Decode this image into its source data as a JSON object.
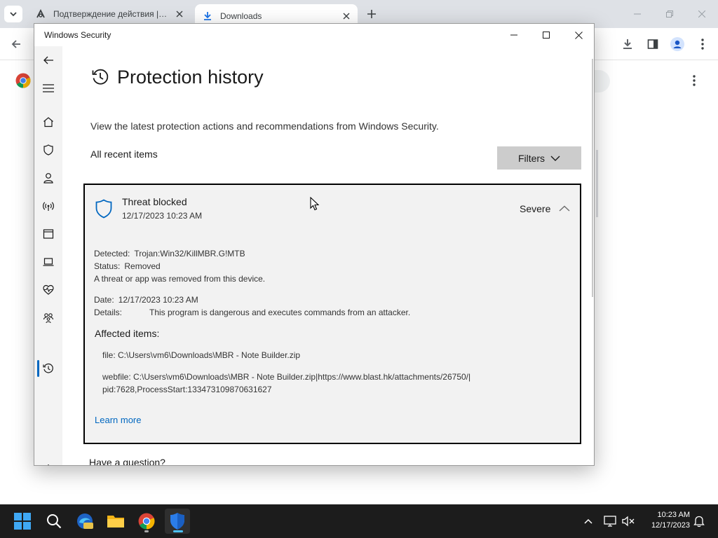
{
  "browser": {
    "tabs": [
      {
        "title": "Подтверждение действия | BL",
        "active": false,
        "icon": "site-favicon-icon"
      },
      {
        "title": "Downloads",
        "active": true,
        "icon": "download-icon"
      }
    ],
    "new_tab_label": "+",
    "window_controls": [
      "minimize-icon",
      "restore-icon",
      "close-icon"
    ]
  },
  "security_window": {
    "title": "Windows Security",
    "controls": [
      "minimize-icon",
      "maximize-icon",
      "close-icon"
    ],
    "nav": [
      {
        "name": "back-icon"
      },
      {
        "name": "menu-icon"
      },
      {
        "name": "home-icon"
      },
      {
        "name": "virus-protection-icon"
      },
      {
        "name": "account-protection-icon"
      },
      {
        "name": "firewall-icon"
      },
      {
        "name": "app-browser-control-icon"
      },
      {
        "name": "device-security-icon"
      },
      {
        "name": "device-health-icon"
      },
      {
        "name": "family-options-icon"
      },
      {
        "name": "protection-history-icon"
      },
      {
        "name": "settings-icon"
      }
    ],
    "active_nav": "protection-history-icon",
    "page": {
      "title": "Protection history",
      "subtitle": "View the latest protection actions and recommendations from Windows Security.",
      "section_label": "All recent items",
      "filters_label": "Filters"
    },
    "threat": {
      "name": "Threat blocked",
      "timestamp": "12/17/2023 10:23 AM",
      "severity": "Severe",
      "detected_label": "Detected:",
      "detected_value": "Trojan:Win32/KillMBR.G!MTB",
      "status_label": "Status:",
      "status_value": "Removed",
      "status_note": "A threat or app was removed from this device.",
      "date_label": "Date:",
      "date_value": "12/17/2023 10:23 AM",
      "details_label": "Details:",
      "details_value": "This program is dangerous and executes commands from an attacker.",
      "affected_heading": "Affected items:",
      "affected_items": [
        "file: C:\\Users\\vm6\\Downloads\\MBR - Note Builder.zip",
        "webfile: C:\\Users\\vm6\\Downloads\\MBR - Note Builder.zip|https://www.blast.hk/attachments/26750/|",
        "pid:7628,ProcessStart:133473109870631627"
      ],
      "learn_more": "Learn more"
    },
    "footer_heading": "Have a question?"
  },
  "taskbar": {
    "apps": [
      "start-icon",
      "search-icon",
      "edge-beta-icon",
      "file-explorer-icon",
      "chrome-icon",
      "windows-security-icon"
    ],
    "time": "10:23 AM",
    "date": "12/17/2023"
  },
  "colors": {
    "accent": "#0067c0",
    "card_bg": "#f2f2f2",
    "taskbar": "#1c1c1c"
  }
}
